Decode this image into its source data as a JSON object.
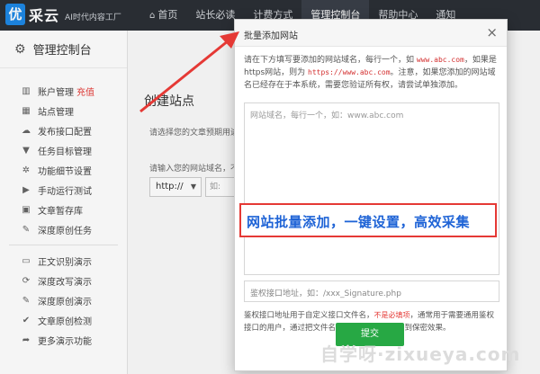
{
  "brand": {
    "badge": "优",
    "name": "采云",
    "slogan": "AI时代内容工厂"
  },
  "nav": {
    "items": [
      {
        "label": "首页",
        "icon": "home-icon",
        "glyph": "⌂"
      },
      {
        "label": "站长必读"
      },
      {
        "label": "计费方式"
      },
      {
        "label": "管理控制台",
        "active": true
      },
      {
        "label": "帮助中心"
      },
      {
        "label": "通知"
      }
    ]
  },
  "sidebar": {
    "header": "管理控制台",
    "group1": [
      {
        "label": "账户管理",
        "badge": "充值",
        "icon": "chart-icon",
        "glyph": "▥"
      },
      {
        "label": "站点管理",
        "icon": "grid-icon",
        "glyph": "▦"
      },
      {
        "label": "发布接口配置",
        "icon": "cloud-upload-icon",
        "glyph": "☁"
      },
      {
        "label": "任务目标管理",
        "icon": "filter-icon",
        "glyph": "▼"
      },
      {
        "label": "功能细节设置",
        "icon": "settings-icon",
        "glyph": "✲"
      },
      {
        "label": "手动运行测试",
        "icon": "play-icon",
        "glyph": "▶"
      },
      {
        "label": "文章暂存库",
        "icon": "database-icon",
        "glyph": "▣"
      },
      {
        "label": "深度原创任务",
        "icon": "edit-icon",
        "glyph": "✎"
      }
    ],
    "group2": [
      {
        "label": "正文识别演示",
        "icon": "monitor-icon",
        "glyph": "▭"
      },
      {
        "label": "深度改写演示",
        "icon": "refresh-icon",
        "glyph": "⟳"
      },
      {
        "label": "深度原创演示",
        "icon": "edit-icon",
        "glyph": "✎"
      },
      {
        "label": "文章原创检测",
        "icon": "check-icon",
        "glyph": "✔"
      },
      {
        "label": "更多演示功能",
        "icon": "share-icon",
        "glyph": "➦"
      }
    ]
  },
  "main": {
    "title": "创建站点",
    "desc": "请选择您的文章预期用途",
    "desc2": "请输入您的网站域名，不",
    "protocol": "http://",
    "domain_placeholder": "如: www."
  },
  "modal": {
    "title": "批量添加网站",
    "close": "×",
    "intro_1": "请在下方填写要添加的网站域名，每行一个，如 ",
    "intro_red_1": "www.abc.com",
    "intro_2": "，如果是https网站，则为 ",
    "intro_red_2": "https://www.abc.com",
    "intro_3": "。注意，如果您添加的网站域名已经存在于本系统，需要您验证所有权，请尝试单独添加。",
    "textarea_placeholder": "网站域名，每行一个，如：www.abc.com",
    "signature_placeholder": "鉴权接口地址，如：/xxx_Signature.php",
    "note_1": "鉴权接口地址用于自定义接口文件名，",
    "note_warn": "不是必填项",
    "note_2": "，通常用于需要通用鉴权接口的用户，通过把文件名改成随机字符串，达到保密效果。",
    "submit": "提交"
  },
  "callout": {
    "text": "网站批量添加，一键设置，高效采集"
  },
  "watermark": "自学呀·zixueya.com",
  "colors": {
    "accent_green": "#27a844",
    "warn_red": "#e53935",
    "callout_blue": "#1e63d6",
    "topbar": "#2b2f36"
  }
}
